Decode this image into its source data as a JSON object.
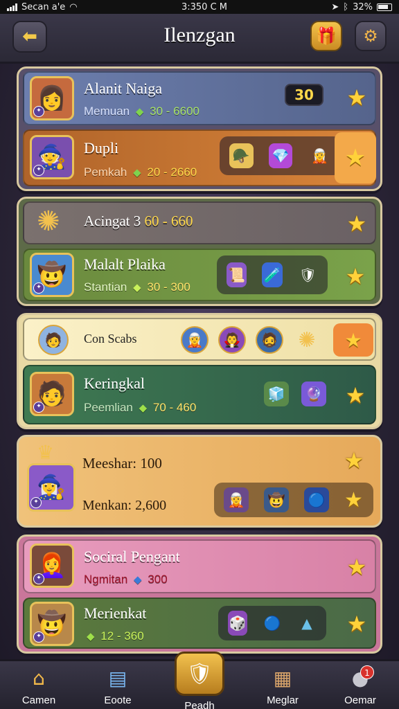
{
  "status": {
    "carrier": "Secan a'e",
    "time": "3:350 C M",
    "battery": "32%"
  },
  "header": {
    "title": "Ilenzgan",
    "back_icon": "arrow-left-icon",
    "chest_icon": "chest-icon",
    "gear_icon": "gear-icon"
  },
  "cards": [
    {
      "rows": [
        {
          "title": "Alanit Naiga",
          "sub_label": "Memuan",
          "sub_range": "30 - 6600",
          "count": "30",
          "color": "#5d6e9a"
        },
        {
          "title": "Dupli",
          "sub_label": "Pemkah",
          "sub_range": "20 - 2660",
          "color": "#b0642a"
        }
      ]
    },
    {
      "rows": [
        {
          "title": "Acingat 3",
          "sub_range": "60 - 660",
          "color": "#6c6468"
        },
        {
          "title": "Malalt Plaika",
          "sub_label": "Stantian",
          "sub_range": "30 - 300",
          "color": "#6b8a3e"
        }
      ]
    },
    {
      "rows": [
        {
          "title": "Con Scabs",
          "color": "#f3e6b4"
        },
        {
          "title": "Keringkal",
          "sub_label": "Peemlian",
          "sub_range": "70 - 460",
          "color": "#3f6a52"
        }
      ]
    },
    {
      "rows": [
        {
          "title": "Meeshar: 100",
          "sub_label": "Menkan: 2,600",
          "color": "#e6a95a"
        }
      ]
    },
    {
      "rows": [
        {
          "title": "Sociral Pengant",
          "sub_label": "Ngmitan",
          "sub_range": "300",
          "color": "#d881a6"
        },
        {
          "title": "Merienkat",
          "sub_range": "12 - 360",
          "color": "#5c7a3c"
        }
      ]
    }
  ],
  "nav": [
    {
      "label": "Camen",
      "icon": "home-icon"
    },
    {
      "label": "Eoote",
      "icon": "card-icon"
    },
    {
      "label": "Peadh",
      "icon": "shield-icon"
    },
    {
      "label": "Meglar",
      "icon": "book-icon"
    },
    {
      "label": "Oemar",
      "icon": "profile-icon",
      "badge": "1"
    }
  ]
}
